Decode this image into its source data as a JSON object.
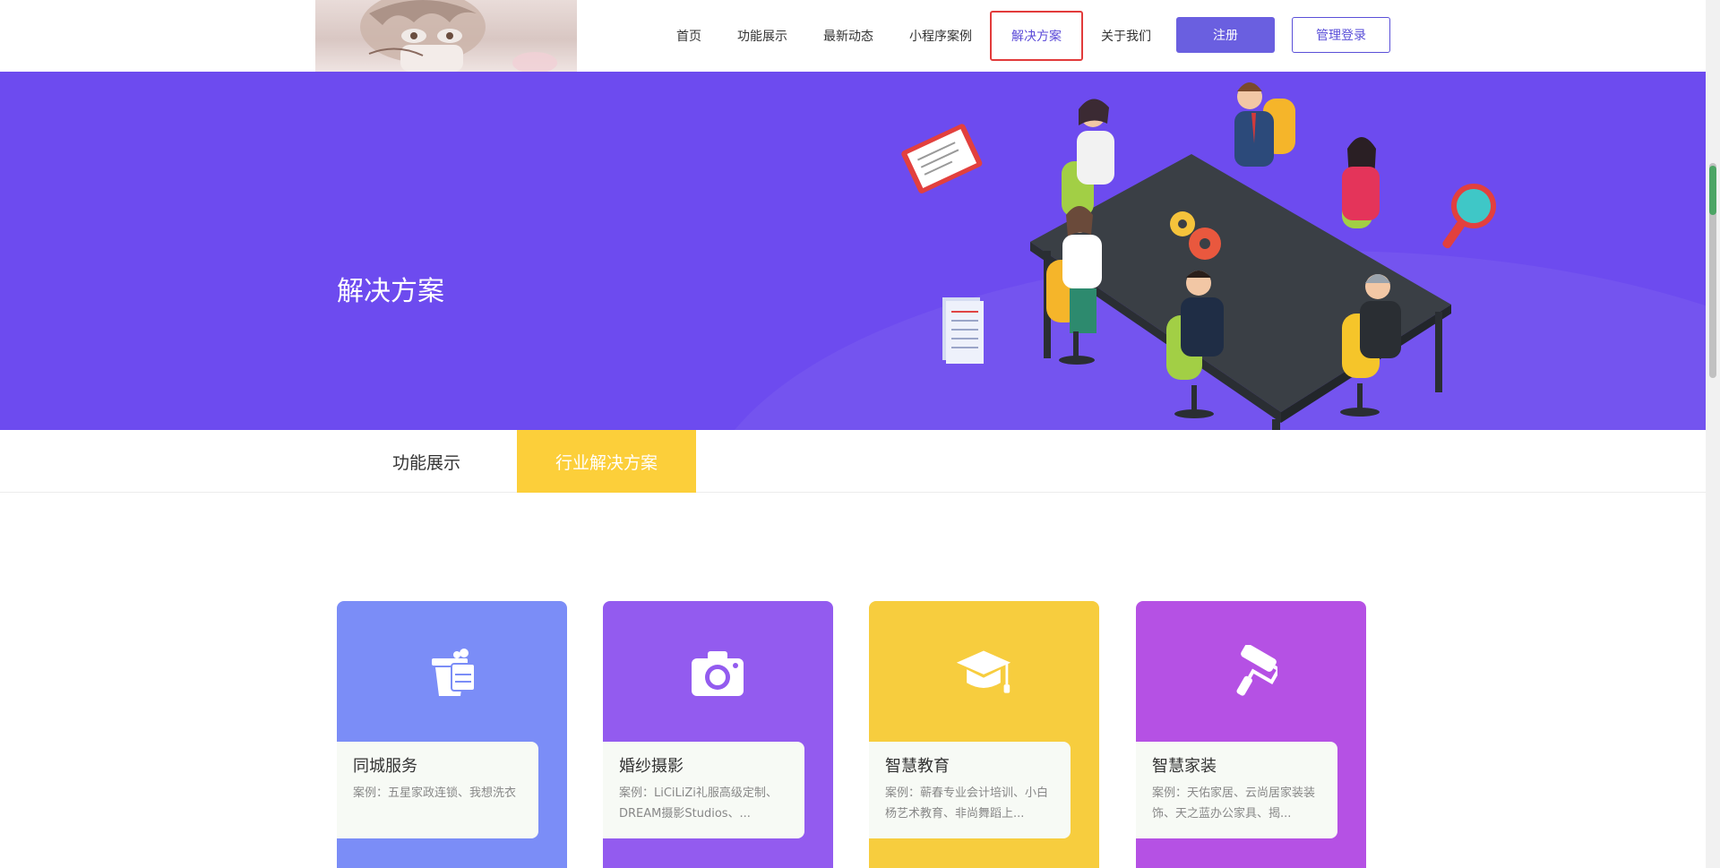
{
  "header": {
    "nav": [
      "首页",
      "功能展示",
      "最新动态",
      "小程序案例",
      "解决方案",
      "关于我们"
    ],
    "active_nav": "解决方案",
    "register_label": "注册",
    "login_label": "管理登录"
  },
  "banner": {
    "title": "解决方案"
  },
  "tabs": [
    "功能展示",
    "行业解决方案"
  ],
  "active_tab": "行业解决方案",
  "cards": [
    {
      "title": "同城服务",
      "desc": "案例：五星家政连锁、我想洗衣",
      "color": "#7b8df7",
      "icon": "cleaning-bucket-icon"
    },
    {
      "title": "婚纱摄影",
      "desc": "案例：LiCiLiZi礼服高级定制、DREAM摄影Studios、...",
      "color": "#935bef",
      "icon": "camera-icon"
    },
    {
      "title": "智慧教育",
      "desc": "案例：蕲春专业会计培训、小白杨艺术教育、非尚舞蹈上...",
      "color": "#f7cd3e",
      "icon": "graduation-cap-icon"
    },
    {
      "title": "智慧家装",
      "desc": "案例：天佑家居、云尚居家装装饰、天之蓝办公家具、揭...",
      "color": "#b551e4",
      "icon": "paint-roller-icon"
    }
  ],
  "colors": {
    "banner_bg": "#6d4bef",
    "accent": "#6a5fe0",
    "tab_active": "#fccf3a",
    "active_border": "#e23b3b"
  }
}
